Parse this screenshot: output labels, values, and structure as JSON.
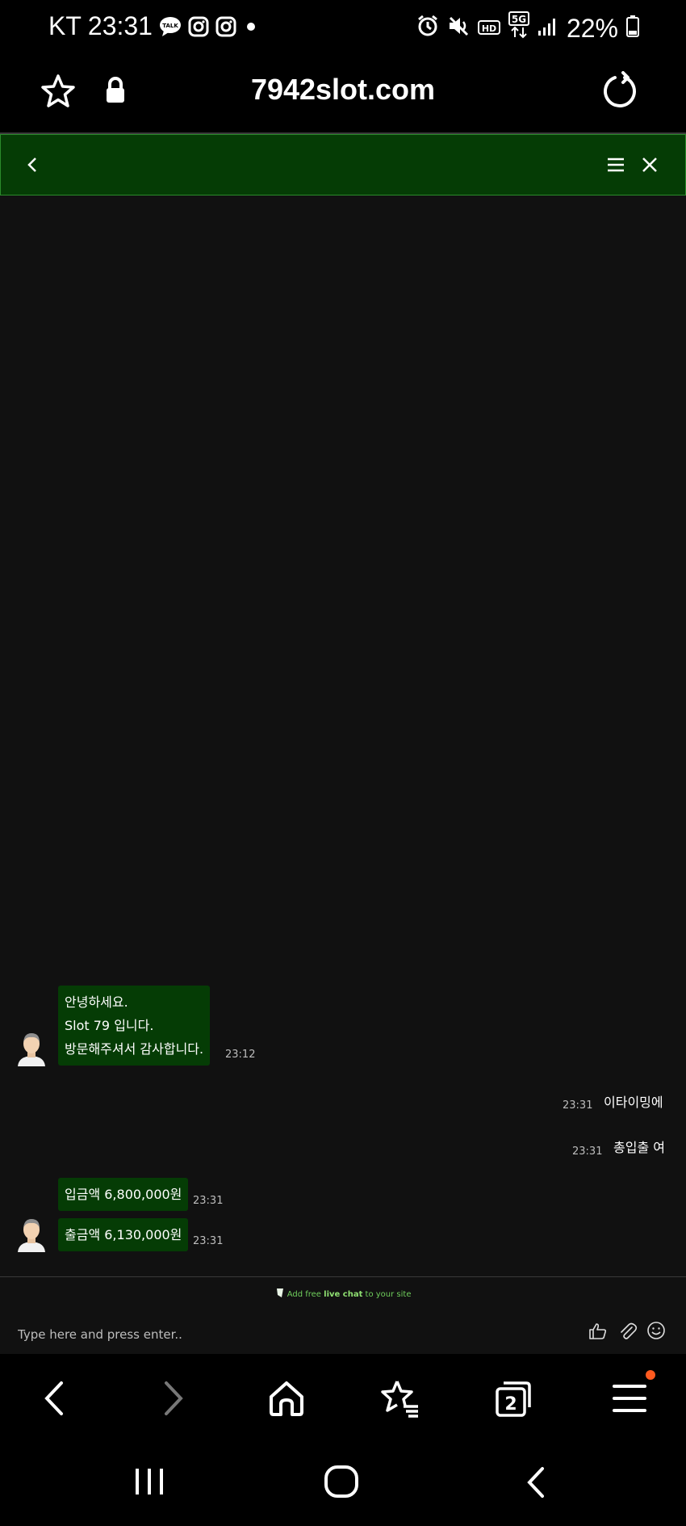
{
  "status_bar": {
    "carrier": "KT",
    "time": "23:31",
    "battery": "22%"
  },
  "browser": {
    "url": "7942slot.com",
    "tab_count": "2"
  },
  "chat": {
    "welcome": {
      "lines": [
        "안녕하세요.",
        "Slot 79 입니다.",
        "방문해주셔서 감사합니다."
      ],
      "time": "23:12"
    },
    "visitor_messages": [
      {
        "text": "이타이밍에",
        "time": "23:31"
      },
      {
        "text": "총입출 여",
        "time": "23:31"
      }
    ],
    "agent_messages": [
      {
        "text": "입금액 6,800,000원",
        "time": "23:31"
      },
      {
        "text": "출금액 6,130,000원",
        "time": "23:31"
      }
    ],
    "powered_prefix": "Add free",
    "powered_bold": "live chat",
    "powered_suffix": "to your site",
    "input_placeholder": "Type here and press enter.."
  },
  "colors": {
    "header_green": "#053c05",
    "bubble_green": "#053c05",
    "chat_bg": "#111111",
    "notification_dot": "#ff5a1f"
  }
}
